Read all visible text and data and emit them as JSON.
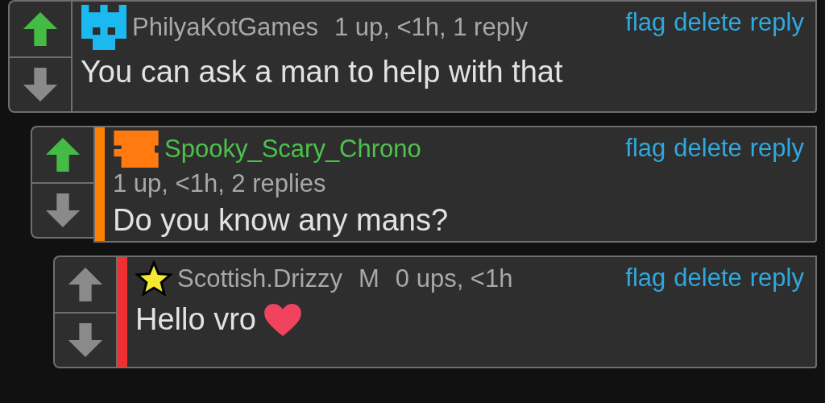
{
  "comments": [
    {
      "kind": "blue-pixel",
      "username": "PhilyaKotGames",
      "highlighted": false,
      "meta": "1 up, <1h, 1 reply",
      "upvoted": true,
      "body": "You can ask a man to help with that",
      "actions": [
        "flag",
        "delete",
        "reply"
      ],
      "replies": [
        {
          "kind": "orange-pixel",
          "username": "Spooky_Scary_Chrono",
          "highlighted": true,
          "color": "#ff8000",
          "meta": "1 up, <1h, 2 replies",
          "upvoted": true,
          "body": "Do you know any mans?",
          "actions": [
            "flag",
            "delete",
            "reply"
          ],
          "replies": [
            {
              "kind": "star",
              "username": "Scottish.Drizzy",
              "highlighted": false,
              "badge": "M",
              "color": "#f03030",
              "meta": "0 ups, <1h",
              "upvoted": false,
              "body": "Hello vro",
              "heart": true,
              "actions": [
                "flag",
                "delete",
                "reply"
              ]
            }
          ]
        }
      ]
    }
  ]
}
